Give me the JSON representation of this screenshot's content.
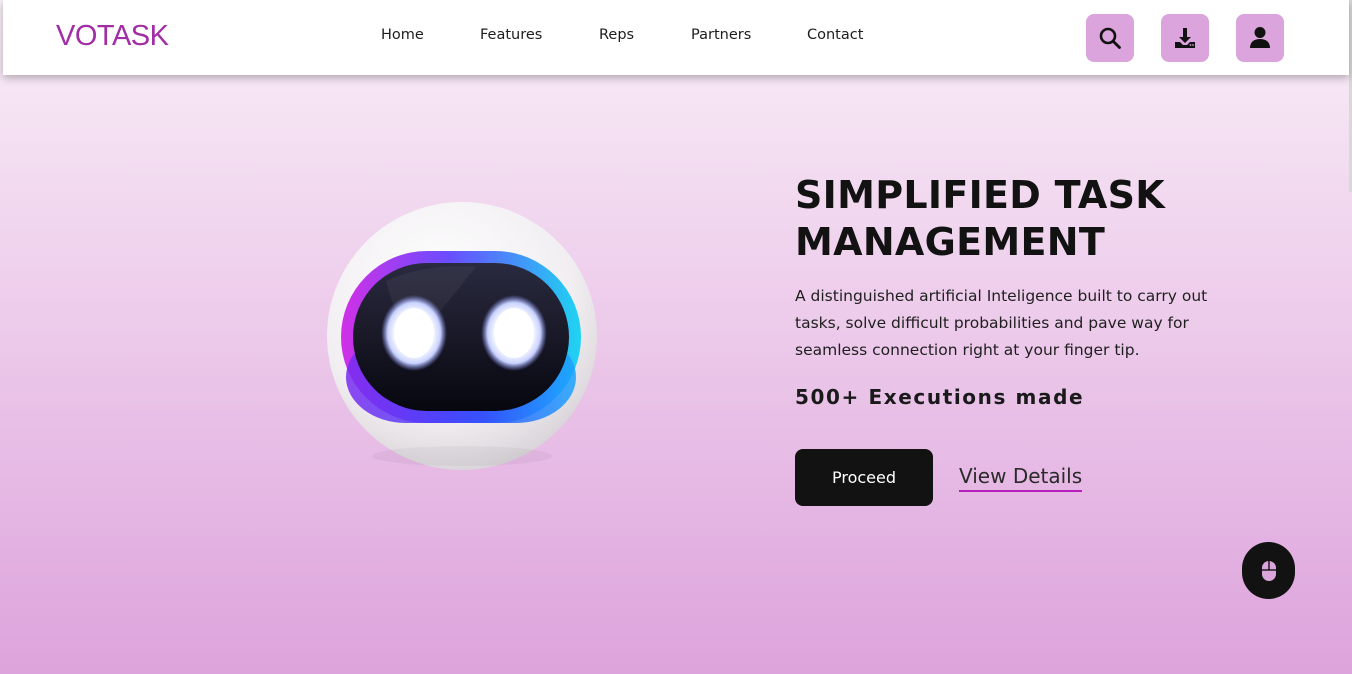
{
  "header": {
    "logo": "VOTASK",
    "nav": [
      "Home",
      "Features",
      "Reps",
      "Partners",
      "Contact"
    ],
    "icons": [
      "search-icon",
      "download-icon",
      "user-icon"
    ]
  },
  "hero": {
    "title": "SIMPLIFIED TASK MANAGEMENT",
    "description": "A distinguished artificial Inteligence built to carry out tasks, solve difficult probabilities and pave way for seamless connection right at your finger tip.",
    "stat": "500+ Executions made",
    "primary_button": "Proceed",
    "secondary_link": "View Details"
  },
  "scroll_button_icon": "mouse-icon",
  "colors": {
    "brand": "#a22ea6",
    "icon_button_bg": "#dba4dc",
    "dark": "#121212",
    "link_underline": "#b81fbf"
  }
}
